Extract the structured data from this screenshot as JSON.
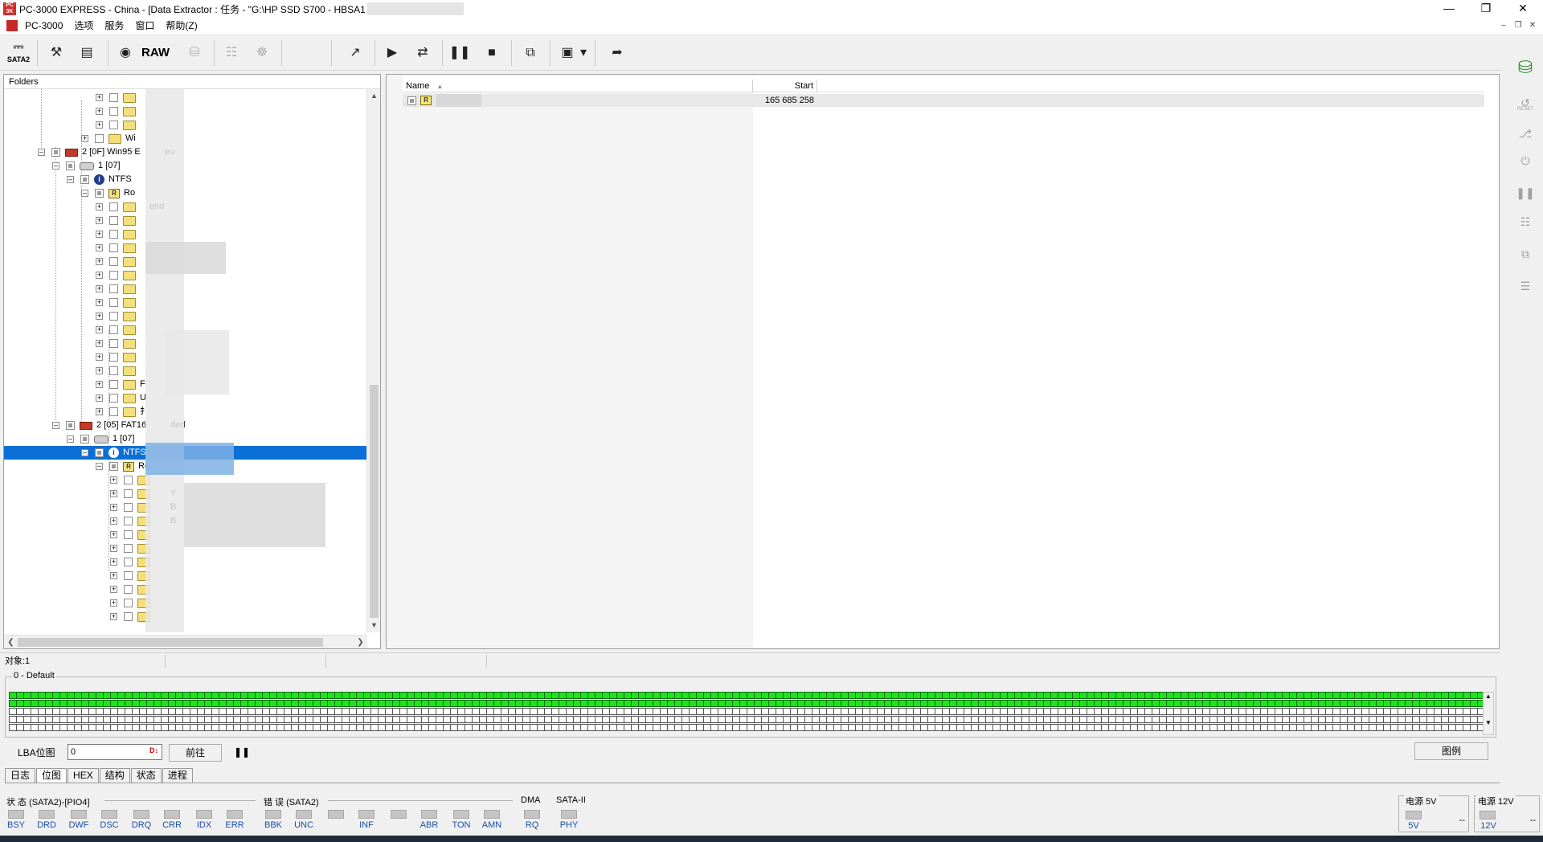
{
  "window": {
    "title": "PC-3000 EXPRESS - China - [Data Extractor : 任务 - \"G:\\HP SSD S700 - HBSA1",
    "app_icon": "pc3000-logo-icon"
  },
  "menu": {
    "items": [
      "PC-3000",
      "选项",
      "服务",
      "窗口",
      "帮助(Z)"
    ]
  },
  "toolbar": {
    "sata_label": "SATA2",
    "raw_label": "RAW"
  },
  "tree": {
    "header": "Folders",
    "rows": [
      {
        "label": "2 [0F] Win95 E",
        "suffix": "eu"
      },
      {
        "label": "1 [07]"
      },
      {
        "label": "NTFS"
      },
      {
        "label": "Ro"
      },
      {
        "label": "end"
      },
      {
        "label": "Wi"
      },
      {
        "label": "F"
      },
      {
        "label": "U"
      },
      {
        "label": "扌"
      },
      {
        "label": "2 [05] FAT16",
        "suffix": "ded"
      },
      {
        "label": "1 [07]"
      },
      {
        "label": "NTFS"
      },
      {
        "label": "Ro"
      },
      {
        "label": "Y"
      },
      {
        "label": "B"
      },
      {
        "label": "B"
      }
    ]
  },
  "filelist": {
    "columns": [
      "Name",
      "Start"
    ],
    "rows": [
      {
        "name": "",
        "start": "165 685 258"
      }
    ]
  },
  "statusstrip": {
    "objects": "对象:1"
  },
  "bitmap": {
    "legend": "0 - Default",
    "green_color": "#1ee31e"
  },
  "lba": {
    "label": "LBA位图",
    "value": "0",
    "goto_button": "前往",
    "pause_icon": "pause-icon",
    "legend_button": "图例"
  },
  "tabs": [
    "日志",
    "位图",
    "HEX",
    "结构",
    "状态",
    "进程"
  ],
  "active_tab": "位图",
  "registers": {
    "status_label": "状 态 (SATA2)-[PIO4]",
    "status_leds": [
      "BSY",
      "DRD",
      "DWF",
      "DSC",
      "DRQ",
      "CRR",
      "IDX",
      "ERR"
    ],
    "error_label": "错 误 (SATA2)",
    "error_leds": [
      "BBK",
      "UNC",
      "",
      "INF",
      "",
      "ABR",
      "TON",
      "AMN"
    ],
    "dma_label": "DMA",
    "dma_leds": [
      "RQ"
    ],
    "sata_label": "SATA-II",
    "sata_leds": [
      "PHY"
    ],
    "power5_label": "电源 5V",
    "power5_led": "5V",
    "power5_value": "--",
    "power12_label": "电源 12V",
    "power12_led": "12V",
    "power12_value": "--"
  }
}
